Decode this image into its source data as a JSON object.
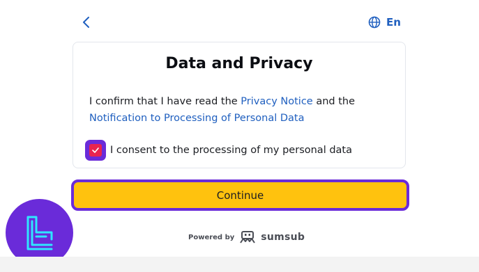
{
  "header": {
    "back_icon": "chevron-left-icon",
    "language_icon": "globe-icon",
    "language_label": "En"
  },
  "card": {
    "title": "Data and Privacy",
    "confirm_prefix": "I confirm that I have read the ",
    "privacy_notice_link": "Privacy Notice",
    "confirm_middle": " and the ",
    "notification_link": "Notification to Processing of Personal Data",
    "consent_label": "I consent to the processing of my personal data",
    "consent_checked": true
  },
  "actions": {
    "continue_label": "Continue"
  },
  "footer": {
    "powered_by": "Powered by",
    "brand_name": "sumsub"
  },
  "colors": {
    "link": "#1f5fbf",
    "accent_purple": "#6a2bd9",
    "button_yellow": "#ffc20e",
    "checkbox_red": "#e8244f"
  }
}
